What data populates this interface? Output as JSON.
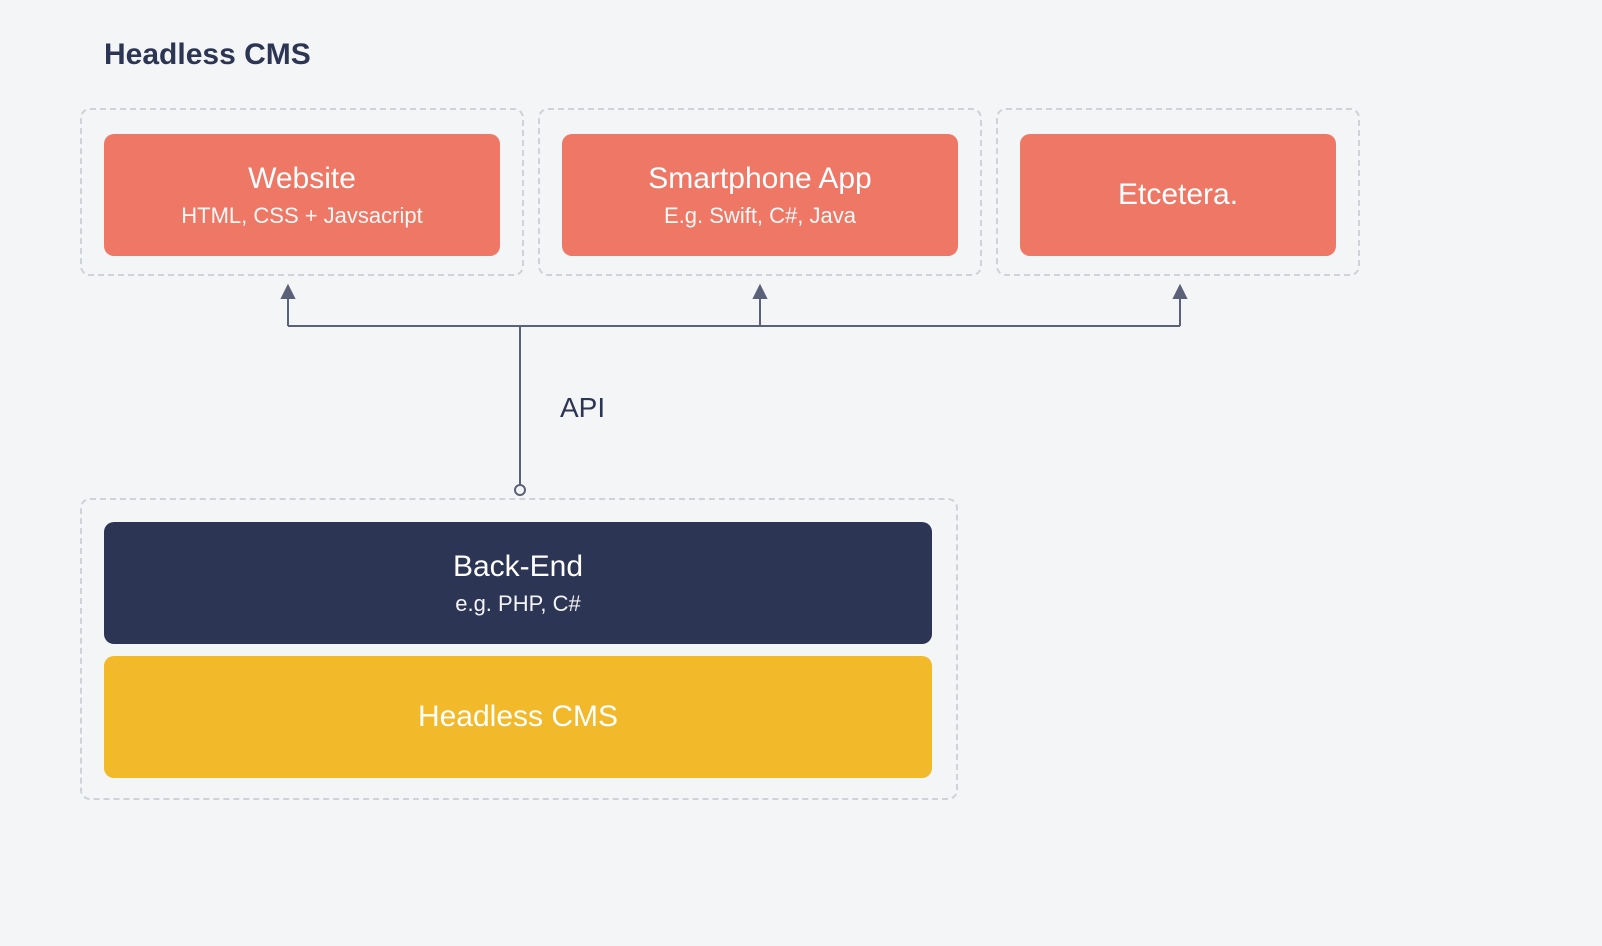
{
  "title": "Headless CMS",
  "frontends": [
    {
      "title": "Website",
      "subtitle": "HTML, CSS + Javsacript"
    },
    {
      "title": "Smartphone App",
      "subtitle": "E.g. Swift, C#, Java"
    },
    {
      "title": "Etcetera.",
      "subtitle": ""
    }
  ],
  "connector_label": "API",
  "backend": {
    "title": "Back-End",
    "subtitle": "e.g. PHP, C#"
  },
  "cms_block": {
    "title": "Headless CMS"
  },
  "colors": {
    "coral": "#ee7766",
    "navy": "#2c3554",
    "gold": "#f2b92b",
    "dashed": "#cfd3d8",
    "line": "#5a6178",
    "bg": "#f4f5f6"
  }
}
